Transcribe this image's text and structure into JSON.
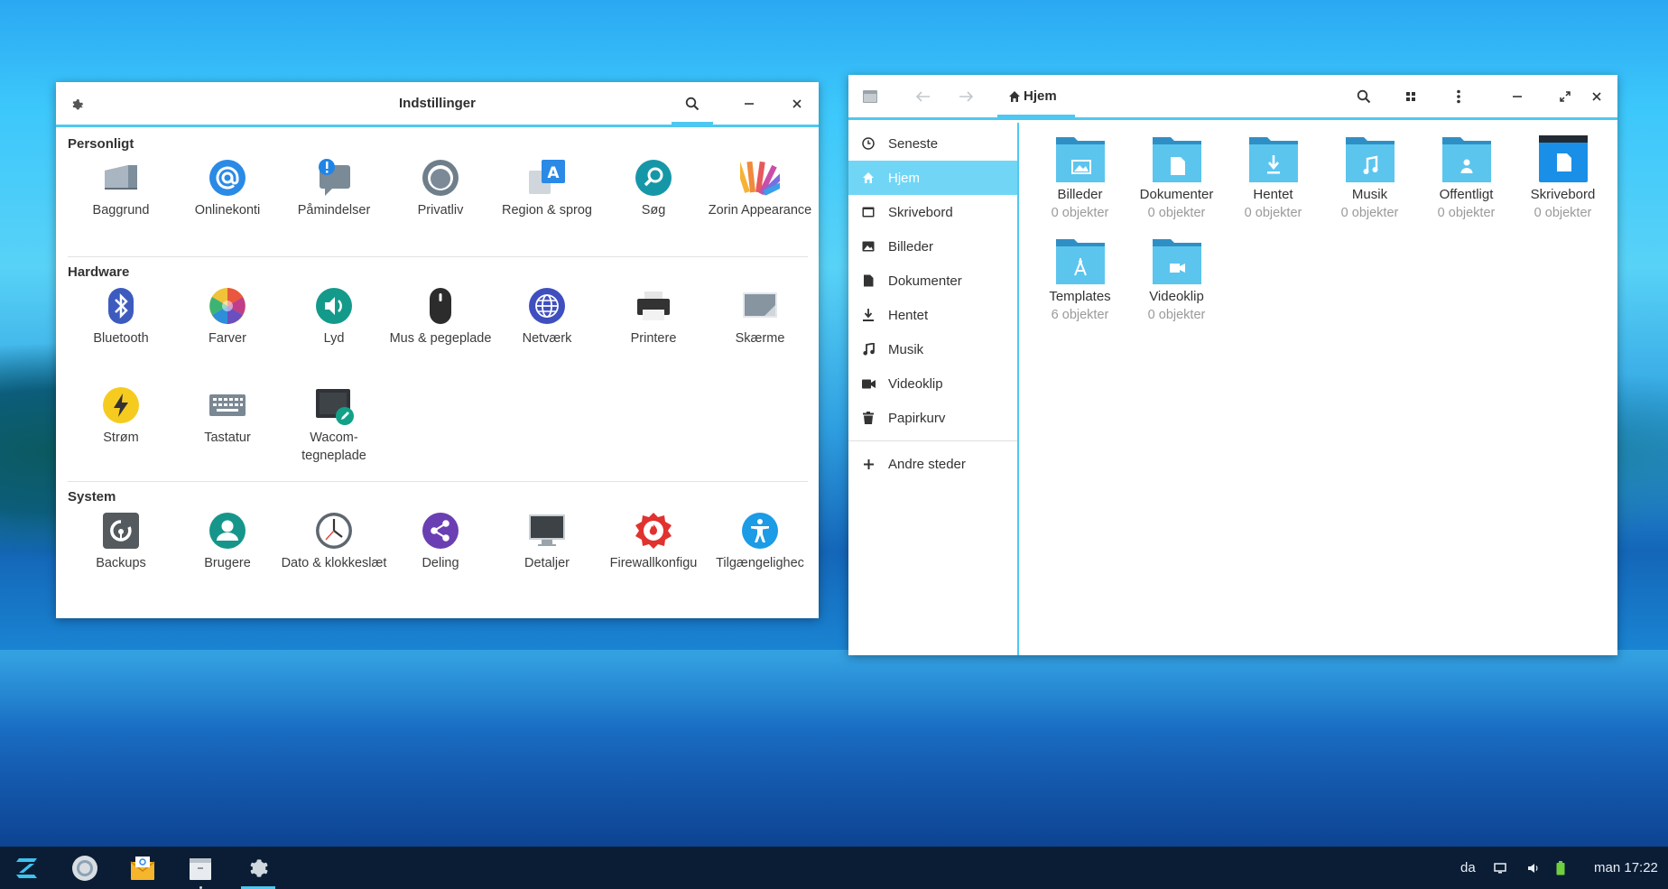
{
  "settings": {
    "title": "Indstillinger",
    "sections": {
      "personal": {
        "title": "Personligt",
        "items": [
          "Baggrund",
          "Onlinekonti",
          "Påmindelser",
          "Privatliv",
          "Region & sprog",
          "Søg",
          "Zorin Appearance"
        ]
      },
      "hardware": {
        "title": "Hardware",
        "items": [
          "Bluetooth",
          "Farver",
          "Lyd",
          "Mus & pegeplade",
          "Netværk",
          "Printere",
          "Skærme",
          "Strøm",
          "Tastatur",
          "Wacom-tegneplade"
        ]
      },
      "system": {
        "title": "System",
        "items": [
          "Backups",
          "Brugere",
          "Dato & klokkeslæt",
          "Deling",
          "Detaljer",
          "Firewallkonfigu",
          "Tilgængelighec"
        ]
      }
    }
  },
  "files": {
    "location": "Hjem",
    "sidebar": [
      "Seneste",
      "Hjem",
      "Skrivebord",
      "Billeder",
      "Dokumenter",
      "Hentet",
      "Musik",
      "Videoklip",
      "Papirkurv"
    ],
    "other_places": "Andre steder",
    "folders": [
      {
        "name": "Billeder",
        "count": "0 objekter",
        "icon": "pictures-folder-icon"
      },
      {
        "name": "Dokumenter",
        "count": "0 objekter",
        "icon": "documents-folder-icon"
      },
      {
        "name": "Hentet",
        "count": "0 objekter",
        "icon": "downloads-folder-icon"
      },
      {
        "name": "Musik",
        "count": "0 objekter",
        "icon": "music-folder-icon"
      },
      {
        "name": "Offentligt",
        "count": "0 objekter",
        "icon": "public-folder-icon"
      },
      {
        "name": "Skrivebord",
        "count": "0 objekter",
        "icon": "desktop-folder-icon"
      },
      {
        "name": "Templates",
        "count": "6 objekter",
        "icon": "templates-folder-icon"
      },
      {
        "name": "Videoklip",
        "count": "0 objekter",
        "icon": "videos-folder-icon"
      }
    ]
  },
  "taskbar": {
    "language": "da",
    "clock": "man 17:22"
  },
  "colors": {
    "accent": "#4ec8f0",
    "folder": "#5bc5ee",
    "taskbar": "#0b1d35"
  }
}
